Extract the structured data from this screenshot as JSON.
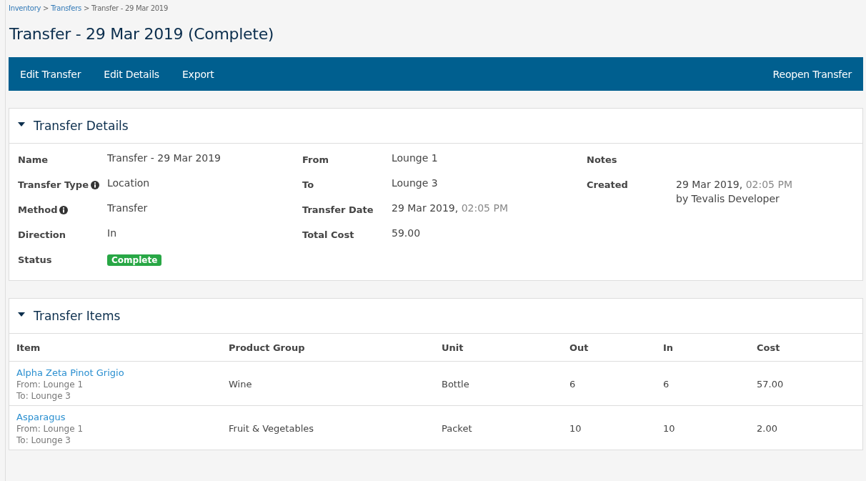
{
  "breadcrumb": [
    {
      "kind": "link",
      "label": "Inventory"
    },
    {
      "kind": "separator",
      "label": ">"
    },
    {
      "kind": "link",
      "label": "Transfers"
    },
    {
      "kind": "separator",
      "label": ">"
    },
    {
      "kind": "current",
      "label": "Transfer - 29 Mar 2019"
    }
  ],
  "title": "Transfer - 29 Mar 2019 (Complete)",
  "toolbar": {
    "left": [
      "Edit Transfer",
      "Edit Details",
      "Export"
    ],
    "right": [
      "Reopen Transfer"
    ]
  },
  "details": {
    "title": "Transfer Details",
    "expanded": true,
    "columns": [
      [
        {
          "label": "Name",
          "info": false,
          "kind": "text",
          "value": "Transfer - 29 Mar 2019"
        },
        {
          "label": "Transfer Type",
          "info": true,
          "kind": "text",
          "value": "Location"
        },
        {
          "label": "Method",
          "info": true,
          "kind": "text",
          "value": "Transfer"
        },
        {
          "label": "Direction",
          "info": false,
          "kind": "text",
          "value": "In"
        },
        {
          "label": "Status",
          "info": false,
          "kind": "badge",
          "value": "Complete",
          "color": "#28a745"
        }
      ],
      [
        {
          "label": "From",
          "info": false,
          "kind": "text",
          "value": "Lounge 1"
        },
        {
          "label": "To",
          "info": false,
          "kind": "text",
          "value": "Lounge 3"
        },
        {
          "label": "Transfer Date",
          "info": false,
          "kind": "datetime",
          "value": "29 Mar 2019,",
          "time": "02:05 PM"
        },
        {
          "label": "Total Cost",
          "info": false,
          "kind": "text",
          "value": "59.00"
        }
      ],
      [
        {
          "label": "Notes",
          "info": false,
          "kind": "empty"
        },
        {
          "label": "Created",
          "info": false,
          "kind": "created",
          "value": "29 Mar 2019,",
          "time": "02:05 PM",
          "by": "by Tevalis Developer"
        }
      ]
    ]
  },
  "items": {
    "title": "Transfer Items",
    "expanded": true,
    "columns": [
      "Item",
      "Product Group",
      "Unit",
      "Out",
      "In",
      "Cost"
    ],
    "rows": [
      {
        "item": "Alpha Zeta Pinot Grigio",
        "from": "From: Lounge 1",
        "to": "To: Lounge 3",
        "group": "Wine",
        "unit": "Bottle",
        "out": "6",
        "in": "6",
        "cost": "57.00"
      },
      {
        "item": "Asparagus",
        "from": "From: Lounge 1",
        "to": "To: Lounge 3",
        "group": "Fruit & Vegetables",
        "unit": "Packet",
        "out": "10",
        "in": "10",
        "cost": "2.00"
      }
    ]
  }
}
